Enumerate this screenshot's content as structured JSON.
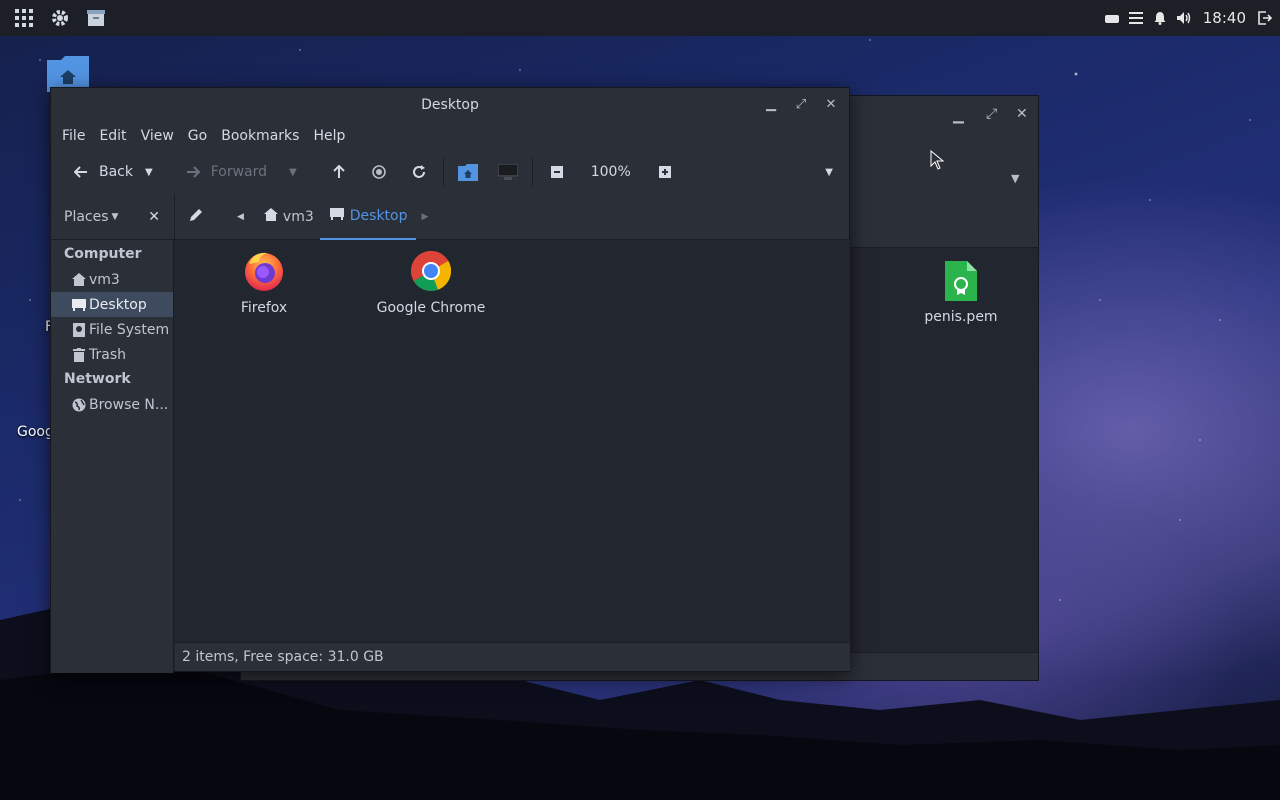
{
  "panel": {
    "clock": "18:40"
  },
  "desktop": {
    "partial_label_1": "F",
    "partial_label_2": "Goog"
  },
  "back_window": {
    "file_name": "penis.pem"
  },
  "window": {
    "title": "Desktop",
    "menu": [
      "File",
      "Edit",
      "View",
      "Go",
      "Bookmarks",
      "Help"
    ],
    "toolbar": {
      "back_label": "Back",
      "forward_label": "Forward",
      "zoom_level": "100%"
    },
    "location": {
      "places_label": "Places",
      "crumbs": [
        "vm3",
        "Desktop"
      ]
    },
    "sidebar": {
      "computer_heading": "Computer",
      "computer_items": [
        "vm3",
        "Desktop",
        "File System",
        "Trash"
      ],
      "network_heading": "Network",
      "network_items": [
        "Browse N..."
      ]
    },
    "files": [
      {
        "name": "Firefox",
        "icon": "firefox-icon"
      },
      {
        "name": "Google Chrome",
        "icon": "chrome-icon"
      }
    ],
    "status": "2 items, Free space: 31.0 GB"
  },
  "colors": {
    "accent": "#5294e2",
    "panel_bg": "#1c1f26",
    "window_bg": "#22262e",
    "chrome_bg": "#2b2f37",
    "selected_bg": "#3e4a5e",
    "pem_icon": "#2bb34c"
  }
}
